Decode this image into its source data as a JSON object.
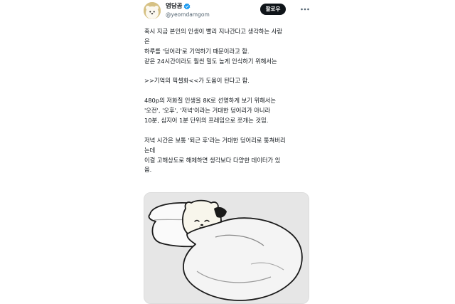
{
  "tweet": {
    "author": {
      "display_name": "염담곰",
      "handle": "@yeomdamgom",
      "verified": true,
      "avatar_icon": "bear-avatar"
    },
    "follow_label": "팔로우",
    "more_icon": "more-horizontal-icon",
    "body_lines": [
      "혹시 지금 본인의 인생이 빨리 지나간다고 생각하는 사람",
      "은",
      "하루를 '덩어리'로 기억하기 때문이라고 함.",
      "같은 24시간이라도 훨씬 밀도 높게 인식하기 위해서는",
      "",
      ">>기억의 픽셀화<<가 도움이 된다고 함.",
      "",
      "480p의 저화질 인생을 8K로 선명하게 보기 위해서는",
      "'오전', '오후', '저녁'이라는 거대한 덩어리가 아니라",
      "10분, 심지어 1분 단위의 프레임으로 쪼개는 것임.",
      "",
      "저녁 시간은 보통 '퇴근 후'라는 거대한 덩어리로 퉁쳐버리",
      "는데",
      "이걸 고해상도로 해체하면 생각보다 다양한 데이터가 있",
      "음."
    ],
    "media": {
      "description_icon": "sleeping-bear-illustration"
    }
  },
  "colors": {
    "text": "#0f1419",
    "secondary_text": "#536471",
    "verified": "#1d9bf0",
    "follow_button": "#0f1419",
    "media_background": "#e6e6e6"
  }
}
